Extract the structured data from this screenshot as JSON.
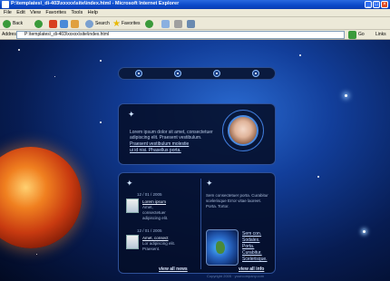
{
  "window": {
    "title": "P:\\templates\\_di-403\\xxxxx\\site\\index.html - Microsoft Internet Explorer"
  },
  "menu": [
    "File",
    "Edit",
    "View",
    "Favorites",
    "Tools",
    "Help"
  ],
  "toolbar": {
    "back": "Back",
    "search": "Search",
    "favorites": "Favorites"
  },
  "address": {
    "label": "Address",
    "value": "P:\\templates\\_di-403\\xxxxx\\site\\index.html",
    "go": "Go",
    "links": "Links"
  },
  "intro": {
    "text": "Lorem ipsum dolor sit amet, consectetuer adipiscing elit. Praesent vestibulum.",
    "link1": "Praesent vestibulum molestie",
    "link2": "ui id nisi. Phasellus porta."
  },
  "news": {
    "items": [
      {
        "date": "12 / 01 / 2005",
        "title": "Lorem ipsum",
        "text": "Amet, consectetuer adipiscing elit."
      },
      {
        "date": "12 / 01 / 2005",
        "title": "Amet, consect",
        "text": "Lor adipiscing elit. Praesent."
      }
    ],
    "view_all": "view all news"
  },
  "info": {
    "text": "Sem consectetuer porta. Curabitur scelerisque Error vitae laoreet. Porta. Tortor.",
    "links": [
      "Sem con.",
      "Sodales.",
      "Porta.",
      "Curabitur.",
      "Scelerisque."
    ],
    "view_all": "view all info"
  },
  "footer": {
    "copyright": "Copyright 2005 · yourcompany.com"
  }
}
